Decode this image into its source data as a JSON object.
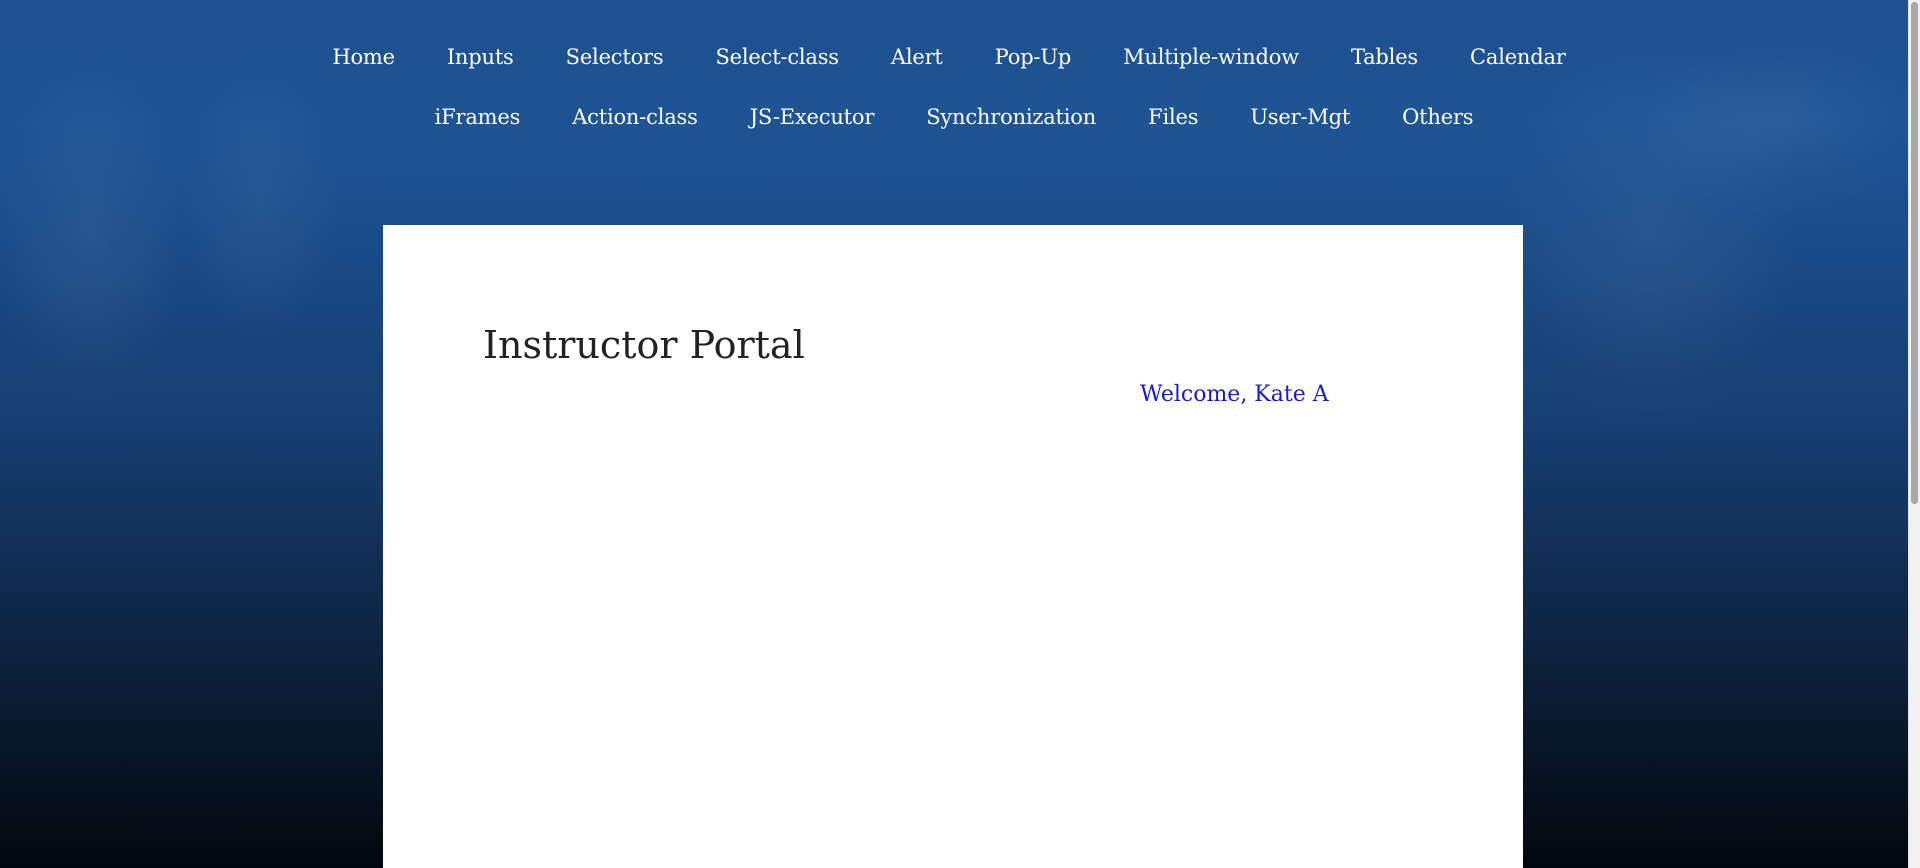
{
  "nav": {
    "row1": [
      "Home",
      "Inputs",
      "Selectors",
      "Select-class",
      "Alert",
      "Pop-Up",
      "Multiple-window",
      "Tables",
      "Calendar"
    ],
    "row2": [
      "iFrames",
      "Action-class",
      "JS-Executor",
      "Synchronization",
      "Files",
      "User-Mgt",
      "Others"
    ]
  },
  "main": {
    "title": "Instructor Portal",
    "welcome": "Welcome, Kate A"
  },
  "colors": {
    "background_top": "#1e5494",
    "background_bottom": "#02070d",
    "nav_text": "#ffffff",
    "welcome_text": "#1a1ad4",
    "title_text": "#222222"
  }
}
